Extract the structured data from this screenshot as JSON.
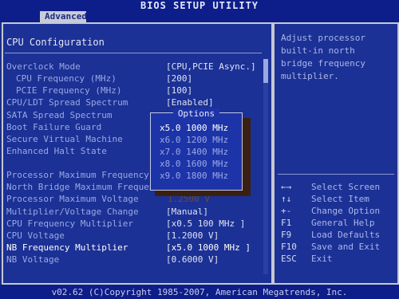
{
  "title": "BIOS SETUP UTILITY",
  "tab": "Advanced",
  "section_title": "CPU Configuration",
  "settings": [
    {
      "label": "Overclock Mode",
      "value": "[CPU,PCIE Async.]"
    },
    {
      "label": "CPU Frequency (MHz)",
      "value": "[200]"
    },
    {
      "label": "PCIE Frequency (MHz)",
      "value": "[100]"
    },
    {
      "label": "CPU/LDT Spread Spectrum",
      "value": "[Enabled]"
    },
    {
      "label": "SATA Spread Spectrum",
      "value": ""
    },
    {
      "label": "Boot Failure Guard",
      "value": ""
    },
    {
      "label": "Secure Virtual Machine",
      "value": ""
    },
    {
      "label": "Enhanced Halt State",
      "value": ""
    },
    {
      "label": "Processor Maximum Frequency",
      "value": ""
    },
    {
      "label": "North Bridge Maximum Frequen",
      "value": ""
    },
    {
      "label": "Processor Maximum Voltage",
      "value": "1.2500 V"
    },
    {
      "label": "Multiplier/Voltage Change",
      "value": "[Manual]"
    },
    {
      "label": "CPU Frequency Multiplier",
      "value": "[x0.5  100 MHz  ]"
    },
    {
      "label": "CPU Voltage",
      "value": "[1.2000 V]"
    },
    {
      "label": "NB Frequency Multiplier",
      "value": "[x5.0  1000 MHz ]"
    },
    {
      "label": "NB Voltage",
      "value": "[0.6000 V]"
    }
  ],
  "help_text": "Adjust processor\nbuilt-in north\nbridge frequency\nmultiplier.",
  "legend": [
    {
      "key": "←→",
      "desc": "Select Screen"
    },
    {
      "key": "↑↓",
      "desc": "Select Item"
    },
    {
      "key": "+-",
      "desc": "Change Option"
    },
    {
      "key": "F1",
      "desc": "General Help"
    },
    {
      "key": "F9",
      "desc": "Load Defaults"
    },
    {
      "key": "F10",
      "desc": "Save and Exit"
    },
    {
      "key": "ESC",
      "desc": "Exit"
    }
  ],
  "popup": {
    "title": "Options",
    "options": [
      "x5.0  1000 MHz",
      "x6.0  1200 MHz",
      "x7.0  1400 MHz",
      "x8.0  1600 MHz",
      "x9.0  1800 MHz"
    ],
    "selected": "x5.0  1000 MHz"
  },
  "footer": "v02.62 (C)Copyright 1985-2007, American Megatrends, Inc."
}
